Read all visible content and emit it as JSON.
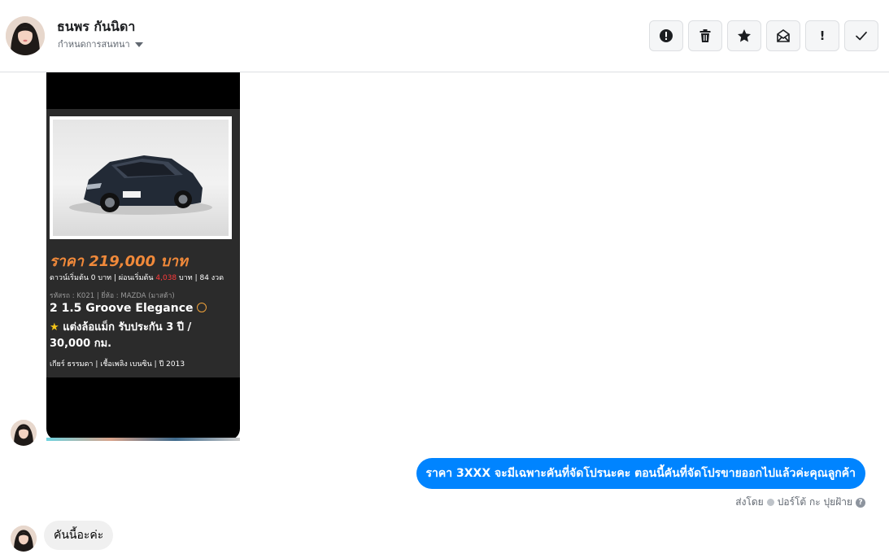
{
  "header": {
    "name": "ธนพร กันนิดา",
    "subtitle": "กำหนดการสนทนา"
  },
  "toolbar": {
    "buttons": [
      {
        "icon": "alert-circle-icon"
      },
      {
        "icon": "trash-icon"
      },
      {
        "icon": "star-icon"
      },
      {
        "icon": "envelope-icon"
      },
      {
        "icon": "exclamation-icon",
        "label": "!"
      },
      {
        "icon": "check-icon"
      }
    ]
  },
  "ad": {
    "price": "ราคา 219,000 บาท",
    "terms_prefix": "ดาวน์เริ่มต้น 0 บาท | ผ่อนเริ่มต้น ",
    "terms_installment": "4,038",
    "terms_suffix": " บาท | 84 งวด",
    "code": "รหัสรถ : K021 | ยี่ห้อ : MAZDA (มาสด้า)",
    "model": "2 1.5 Groove Elegance",
    "features": "แต่งล้อแม็ก รับประกัน 3 ปี / 30,000 กม.",
    "specs": "เกียร์ ธรรมดา   |   เชื้อเพลิง เบนซิน   |   ปี 2013",
    "colors": {
      "price": "#f0893a",
      "installment": "#ff3b3b",
      "card_bg": "#2b2b2b"
    }
  },
  "messages": {
    "outgoing": "ราคา 3XXX จะมีเฉพาะคันที่จัดโปรนะคะ ตอนนี้คันที่จัดโปรขายออกไปแล้วค่ะคุณลูกค้า",
    "sent_by_label": "ส่งโดย",
    "sent_by_name": "ปอร์โต้ กะ ปุยฝ้าย",
    "incoming": "คันนี้อะค่ะ"
  },
  "colors": {
    "accent": "#0084ff"
  }
}
